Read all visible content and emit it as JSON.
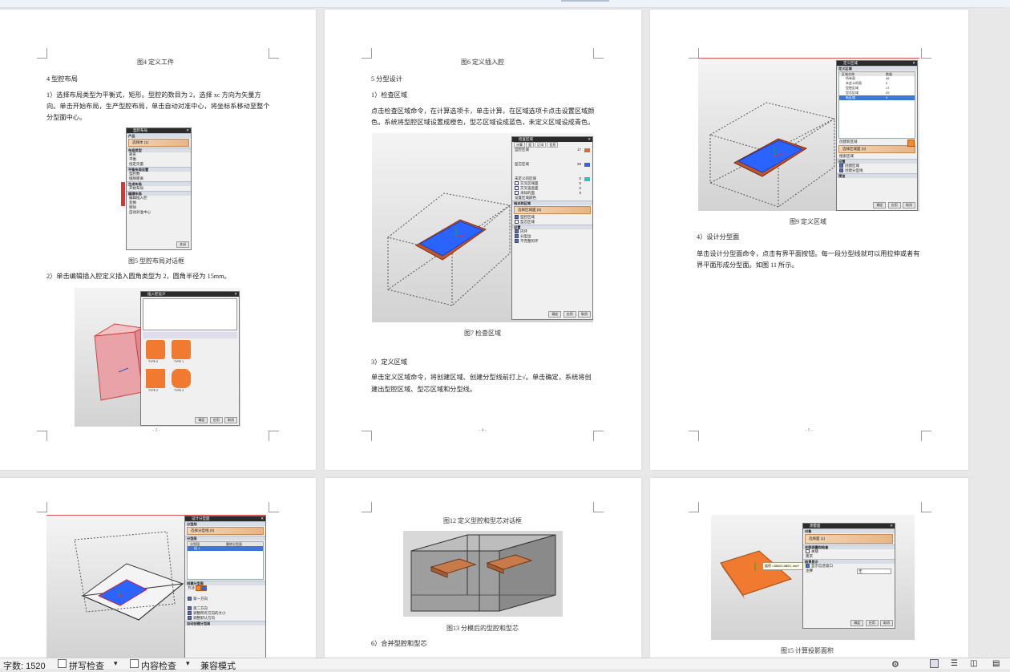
{
  "window": {
    "accent": "#e8e8e8",
    "page_color": "#ffffff"
  },
  "pages": {
    "p3": {
      "fig4_caption": "图4 定义工件",
      "section4_heading": "4 型腔布局",
      "para1_line1": "1）选择布局类型为平衡式，矩形。型腔的数目为 2，选择 xc 方向为矢量方",
      "para1_line2": "向。单击开始布局，生产型腔布局，单击自动对准中心，将坐标系移动至整个",
      "para1_line3": "分型面中心。",
      "fig5_caption": "图5 型腔布局对话框",
      "para2": "2）单击编辑插入腔定义插入圆角类型为 2，圆角半径为 15mm。",
      "page_number": "- 3 -",
      "dlg1_title": "型腔布局",
      "dlg1_rows": [
        "产品",
        "选择体 (1)",
        "布局类型",
        "矩形",
        "平衡",
        "指定矢量",
        "平衡布局设置",
        "型腔数",
        "缝隙距离",
        "生成布局",
        "开始布局",
        "编辑布局",
        "编辑插入腔",
        "变换",
        "移除",
        "自动对准中心"
      ],
      "dlg1_buttons": [
        "关闭"
      ],
      "dlg2_title": "插入腔设计",
      "dlg2_types": [
        "TYPE 0",
        "TYPE 1",
        "TYPE 2",
        "TYPE 3"
      ],
      "dlg2_buttons": [
        "确定",
        "应用",
        "取消"
      ]
    },
    "p4": {
      "fig6_caption": "图6 定义插入腔",
      "section5_heading": "5 分型设计",
      "item1": "1）检查区域",
      "para_a_line1": "点击检查区域命令，在计算选项卡，单击计算，在区域选项卡点击设置区域颜",
      "para_a_line2": "色。系统将型腔区域设置成橙色，型芯区域设成蓝色，未定义区域设成青色。",
      "fig7_caption": "图7 检查区域",
      "item3": "3）定义区域",
      "para_b_line1": "单击定义区域命令，将创建区域、创建分型线前打上√。单击确定，系统将创",
      "para_b_line2": "建出型腔区域、型芯区域和分型线。",
      "page_number": "- 4 -",
      "dlg_title": "检查区域",
      "dlg_tabs": [
        "计算",
        "面",
        "区域",
        "信息"
      ],
      "dlg_rows": [
        {
          "label": "型腔区域",
          "value": "17"
        },
        {
          "label": "型芯区域",
          "value": "29"
        },
        {
          "label": "未定义的区域",
          "value": "0"
        },
        {
          "label": "交叉区域面",
          "value": "0"
        },
        {
          "label": "交叉竖直面",
          "value": "0"
        },
        {
          "label": "未知的面",
          "value": "0"
        }
      ],
      "dlg_set_color": "设置区域颜色",
      "dlg_assign": "指派到区域",
      "dlg_select": "选择区域面 (0)",
      "dlg_radio": [
        "型腔区域",
        "型芯区域"
      ],
      "dlg_settings": [
        "设置",
        "内环",
        "分型边",
        "不完整的环"
      ],
      "dlg_buttons": [
        "确定",
        "应用",
        "取消"
      ]
    },
    "p5": {
      "fig9_caption": "图9 定义区域",
      "item4": "4）设计分型面",
      "para_line1": "单击设计分型面命令，点击有界平面按钮。每一段分型线就可以用拉伸或者有",
      "para_line2": "界平面形成分型面。如图 11 所示。",
      "page_number": "- 5 -",
      "dlg_title": "定义区域",
      "dlg_head": [
        "区域名称",
        "数量"
      ],
      "dlg_rows": [
        {
          "name": "所有面",
          "count": "46"
        },
        {
          "name": "未定义的面",
          "count": "0"
        },
        {
          "name": "型腔区域",
          "count": "17"
        },
        {
          "name": "型芯区域",
          "count": "29"
        },
        {
          "name": "新区域",
          "count": "0"
        }
      ],
      "dlg_create": "创建新区域",
      "dlg_select": "选择区域面 (0)",
      "dlg_search": "搜索区域",
      "dlg_settings": [
        "设置",
        "创建区域",
        "创建分型线"
      ],
      "dlg_preview": "预览",
      "dlg_buttons": [
        "确定",
        "应用",
        "取消"
      ]
    },
    "p6": {
      "dlg_title": "设计分型面",
      "dlg_rows": [
        "分型线",
        "选择分型线 (0)",
        "分型段",
        "分型段",
        "段 1",
        "创建分型面",
        "方法",
        "第一方向",
        "第二方向",
        "调整所有方向的大小",
        "调整默认方向",
        "自动创建分型面"
      ],
      "dlg_col": [
        "分型段",
        "删除分型面",
        "分型面数"
      ]
    },
    "p7": {
      "fig12_caption": "图12 定义型腔和型芯对话框",
      "fig13_caption": "图13 分模后的型腔和型芯",
      "item6": "6）合并型腔和型芯"
    },
    "p8": {
      "dlg_title": "测量面",
      "dlg_rows": [
        "对象",
        "选择面 (1)",
        "关联测量和检查",
        "关联",
        "需求",
        "结果显示",
        "显示信息窗口",
        "注释"
      ],
      "dlg_annot": "无",
      "dlg_measure": "面积 =35021.0803, mm²",
      "dlg_buttons": [
        "确定",
        "应用",
        "取消"
      ],
      "fig15_caption": "图15 计算投影面积"
    }
  },
  "statusbar": {
    "word_count": "字数: 1520",
    "spell_check": "拼写检查",
    "content_check": "内容检查",
    "compat_mode": "兼容模式"
  }
}
